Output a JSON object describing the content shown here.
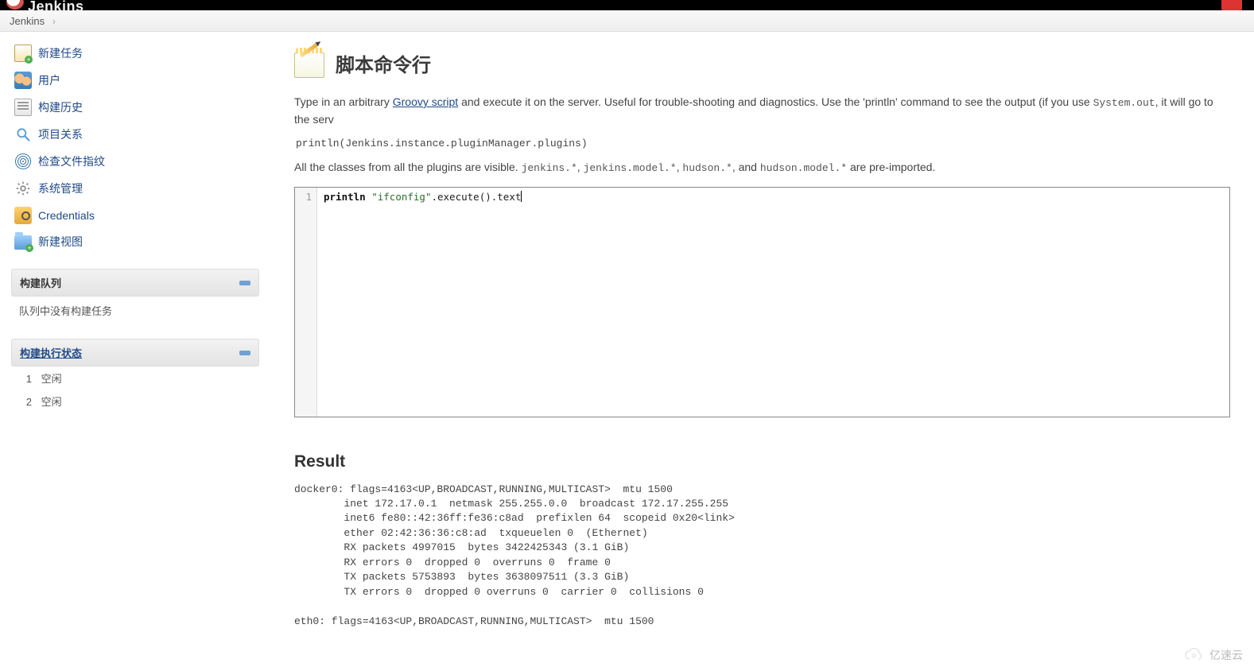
{
  "header": {
    "logo_text": "Jenkins"
  },
  "breadcrumb": {
    "items": [
      "Jenkins"
    ]
  },
  "sidebar": {
    "menu": [
      {
        "id": "new-item",
        "label": "新建任务"
      },
      {
        "id": "people",
        "label": "用户"
      },
      {
        "id": "build-history",
        "label": "构建历史"
      },
      {
        "id": "project-rel",
        "label": "项目关系"
      },
      {
        "id": "fingerprints",
        "label": "检查文件指纹"
      },
      {
        "id": "manage-jenkins",
        "label": "系统管理"
      },
      {
        "id": "credentials",
        "label": "Credentials"
      },
      {
        "id": "new-view",
        "label": "新建视图"
      }
    ],
    "queue": {
      "title": "构建队列",
      "empty_text": "队列中没有构建任务"
    },
    "executors": {
      "title": "构建执行状态",
      "rows": [
        {
          "index": "1",
          "status": "空闲"
        },
        {
          "index": "2",
          "status": "空闲"
        }
      ]
    }
  },
  "main": {
    "title": "脚本命令行",
    "intro_pre": "Type in an arbitrary ",
    "intro_link": "Groovy script",
    "intro_post": " and execute it on the server. Useful for trouble-shooting and diagnostics. Use the 'println' command to see the output (if you use ",
    "intro_code": "System.out",
    "intro_tail": ", it will go to the serv",
    "sample_code": "println(Jenkins.instance.pluginManager.plugins)",
    "classes_pre": "All the classes from all the plugins are visible. ",
    "classes_c1": "jenkins.*",
    "classes_c2": "jenkins.model.*",
    "classes_c3": "hudson.*",
    "classes_mid": ", and ",
    "classes_c4": "hudson.model.*",
    "classes_post": " are pre-imported.",
    "editor": {
      "line_no": "1",
      "tok_kw": "println",
      "tok_sp1": " ",
      "tok_str": "\"ifconfig\"",
      "tok_rest": ".execute().text"
    },
    "result_title": "Result",
    "output": "docker0: flags=4163<UP,BROADCAST,RUNNING,MULTICAST>  mtu 1500\n        inet 172.17.0.1  netmask 255.255.0.0  broadcast 172.17.255.255\n        inet6 fe80::42:36ff:fe36:c8ad  prefixlen 64  scopeid 0x20<link>\n        ether 02:42:36:36:c8:ad  txqueuelen 0  (Ethernet)\n        RX packets 4997015  bytes 3422425343 (3.1 GiB)\n        RX errors 0  dropped 0  overruns 0  frame 0\n        TX packets 5753893  bytes 3638097511 (3.3 GiB)\n        TX errors 0  dropped 0 overruns 0  carrier 0  collisions 0\n\neth0: flags=4163<UP,BROADCAST,RUNNING,MULTICAST>  mtu 1500"
  },
  "watermark": {
    "text": "亿速云"
  }
}
